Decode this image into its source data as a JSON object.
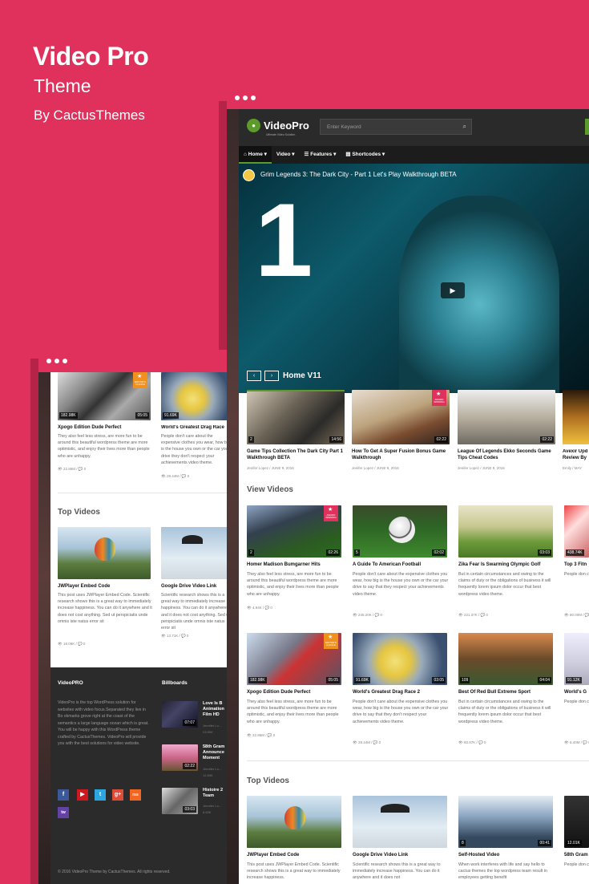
{
  "hero": {
    "title": "Video Pro",
    "subtitle": "Theme",
    "by": "By CactusThemes"
  },
  "left": {
    "cards": [
      {
        "title": "Xpogo Edition Dude Perfect",
        "excerpt": "They also feel less stress, are more fun to be around this beautiful wordpress theme are more optimistic, and enjoy their lives more than people who are unhappy.",
        "views": "22.86M",
        "comments": "0",
        "likes": "182.98K",
        "duration": "05:05",
        "badge": "EDITOR'S CHOICE"
      },
      {
        "title": "World's Greatest Drag Race",
        "excerpt": "People don't care about the expensive clothes you wear, how big is the house you own or the car your drive they don't respect your achievements video theme.",
        "views": "29.44M",
        "comments": "0",
        "likes": "91.69K"
      }
    ],
    "section": "Top Videos",
    "top": [
      {
        "title": "JWPlayer Embed Code",
        "excerpt": "This post uses JWPlayer Embed Code. Scientific research shows this is a great way to immediately increase happiness. You can do it anywhere and it does not cost anything. Sed ut perspiciatis unde omnis iste natus error sit",
        "views": "18.06K",
        "comments": "0"
      },
      {
        "title": "Google Drive Video Link",
        "excerpt": "Scientific research shows this is a great way to immediately increase happiness. You can do it anywhere and it does not cost anything. Sed ut perspiciatis unde omnis iste natus error sit",
        "views": "13.71K",
        "comments": "0"
      }
    ],
    "footer": {
      "about_title": "VideoPRO",
      "about_text": "VideoPro is the top WordPress solution for websites with video focus.Separated they live in Bo okmarks grove right at the coast of the semantics a large language ocean which is great. You will be happy with this WordPress theme crafted by CactusThemes. VideoPro will provide you with the best solutions for video website.",
      "billboards_title": "Billboards",
      "billboards": [
        {
          "title": "Love Is B Animation Film HD",
          "meta": "Jennifer Lo...",
          "views": "23.89K",
          "duration": "07:07"
        },
        {
          "title": "58th Gram Announce Moment",
          "meta": "Jennifer Lo...",
          "views": "12.80K",
          "duration": "02:22"
        },
        {
          "title": "Histoire 2 Team",
          "meta": "Jennifer Lo...",
          "views": "8.83K",
          "duration": "03:03"
        }
      ],
      "copyright": "© 2016 VideoPro Theme by CactusThemes. All rights reserved.",
      "social": [
        "f",
        "▶",
        "t",
        "g+",
        "rss",
        "tw"
      ]
    }
  },
  "right": {
    "logo": "VideoPro",
    "logo_sub": "Ultimate Video Solution",
    "search_placeholder": "Enter Keyword",
    "nav": [
      "Home ▾",
      "Video ▾",
      "Features ▾",
      "Shortcodes ▾"
    ],
    "player": {
      "title": "Grim Legends 3: The Dark City - Part 1 Let's Play Walkthrough BETA",
      "slide_label": "Home V11",
      "big_number": "1"
    },
    "carousel": [
      {
        "title": "Game Tips Collection The Dark City Part 1 Walkthrough BETA",
        "meta": "Jenifer Lopez / JUNE 9, 2016",
        "duration": "14:56",
        "likes": "2"
      },
      {
        "title": "How To Get A Super Fusion Bonus Game Walkthrough",
        "meta": "Jenifer Lopez / JUNE 9, 2016",
        "duration": "02:22",
        "badge": "AWARD WINNING"
      },
      {
        "title": "League Of Legends Ekko Seconds Game Tips Cheat Codes",
        "meta": "Jenifer Lopez / JUNE 9, 2016",
        "duration": "02:22"
      },
      {
        "title": "Avexir Upd Review By",
        "meta": "Emily / MAY"
      }
    ],
    "view_videos": "View Videos",
    "grid": [
      {
        "title": "Homer Madison Bumgarner Hits",
        "excerpt": "They also feel less stress, are more fun to be around this beautiful wordpress theme are more optimistic, and enjoy their lives more than people who are unhappy.",
        "views": "4.94K",
        "comments": "0",
        "likes": "2",
        "duration": "02:26",
        "badge": "AWARD WINNING"
      },
      {
        "title": "A Guide To American Football",
        "excerpt": "People don't care about the expensive clothes you wear, how big is the house you own or the car your drive to say that they respect your achievements video theme.",
        "views": "245.20K",
        "comments": "0",
        "likes": "5",
        "duration": "02:02"
      },
      {
        "title": "Zika Fear Is Swarming Olympic Golf",
        "excerpt": "But in certain circumstances and owing to the claims of duty or the obligations of business it will frequently lorem ipsum dolor occur that best wordpress video theme.",
        "views": "221.37K",
        "comments": "0",
        "duration": "03:03"
      },
      {
        "title": "Top 3 Fitn",
        "excerpt": "People don clothes you you own or they don't r video them",
        "views": "80.00M",
        "comments": "0",
        "likes": "438.74K"
      },
      {
        "title": "Xpogo Edition Dude Perfect",
        "excerpt": "They also feel less stress, are more fun to be around this beautiful wordpress theme are more optimistic, and enjoy their lives more than people who are unhappy.",
        "views": "22.86M",
        "comments": "0",
        "likes": "182.98K",
        "duration": "05:05",
        "badge": "EDITOR'S CHOICE"
      },
      {
        "title": "World's Greatest Drag Race 2",
        "excerpt": "People don't care about the expensive clothes you wear, how big is the house you own or the car your drive to say that they don't respect your achievements video theme.",
        "views": "29.44M",
        "comments": "0",
        "likes": "91.69K",
        "duration": "03:05"
      },
      {
        "title": "Best Of Red Bull Extreme Sport",
        "excerpt": "But in certain circumstances and owing to the claims of duty or the obligations of business it will frequently lorem ipsum dolor occur that best wordpress video theme.",
        "views": "60.97K",
        "comments": "0",
        "likes": "109",
        "duration": "04:04"
      },
      {
        "title": "World's G",
        "excerpt": "People don clothes you you own or they don't r video them",
        "views": "6.40M",
        "comments": "0",
        "likes": "91.12K"
      }
    ],
    "top_videos": "Top Videos",
    "top": [
      {
        "title": "JWPlayer Embed Code",
        "excerpt": "This post uses JWPlayer Embed Code. Scientific research shows this is a great way to immediately increase happiness."
      },
      {
        "title": "Google Drive Video Link",
        "excerpt": "Scientific research shows this is a great way to immediately increase happiness. You can do it anywhere and it does not"
      },
      {
        "title": "Self-Hosted Video",
        "excerpt": "When work interferes with life and say hello to cactus themes the top wordpress team result in employees getting benefit",
        "likes": "8",
        "duration": "00:41"
      },
      {
        "title": "58th Gram",
        "excerpt": "People don clothes you you own or",
        "likes": "12.01K"
      }
    ]
  }
}
